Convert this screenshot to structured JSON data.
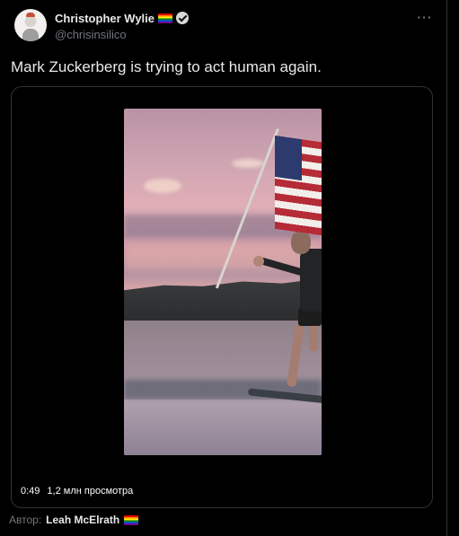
{
  "tweet": {
    "author": {
      "display_name": "Christopher Wylie",
      "handle": "@chrisinsilico",
      "verified": true,
      "badge_icon": "rainbow-flag-icon"
    },
    "more_label": "···",
    "text": "Mark Zuckerberg is trying to act human again.",
    "media": {
      "type": "video",
      "duration": "0:49",
      "views": "1,2 млн просмотра"
    },
    "attribution": {
      "prefix": "Автор:",
      "author": "Leah McElrath",
      "badge_icon": "rainbow-flag-icon"
    }
  },
  "colors": {
    "background": "#000000",
    "text_primary": "#e7e9ea",
    "text_secondary": "#71767b",
    "border": "#2f3336"
  }
}
